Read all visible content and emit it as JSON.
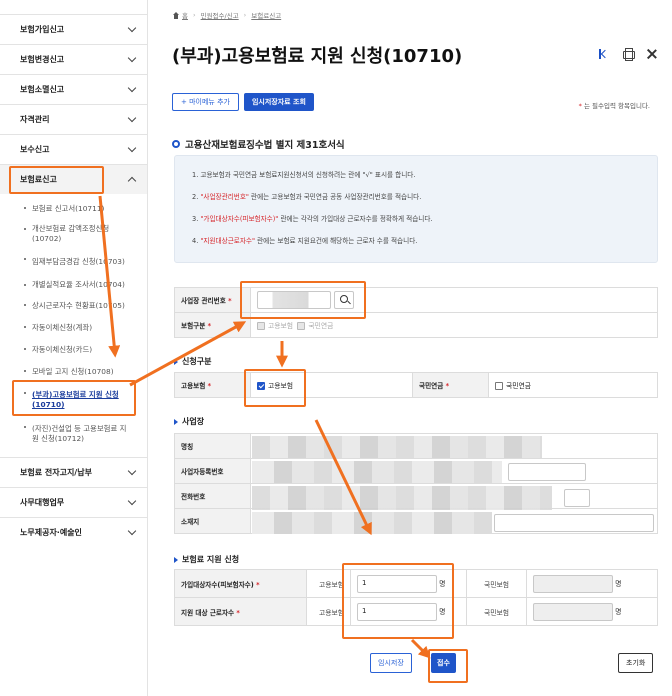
{
  "sidebar": {
    "items": [
      {
        "label": "보험가입신고"
      },
      {
        "label": "보험변경신고"
      },
      {
        "label": "보험소멸신고"
      },
      {
        "label": "자격관리"
      },
      {
        "label": "보수신고"
      },
      {
        "label": "보험료신고"
      },
      {
        "label": "보험료 전자고지/납부"
      },
      {
        "label": "사무대행업무"
      },
      {
        "label": "노무제공자·예술인"
      }
    ],
    "sub_items": [
      {
        "label": "보험료 신고서(10711)"
      },
      {
        "label": "개산보험료 감액조정신청 (10702)"
      },
      {
        "label": "임재부담금경감 신청(10703)"
      },
      {
        "label": "개별실적요율 조사서(10704)"
      },
      {
        "label": "상시근로자수 현황표(10705)"
      },
      {
        "label": "자동이체신청(계좌)"
      },
      {
        "label": "자동이체신청(카드)"
      },
      {
        "label": "모바일 고지 신청(10708)"
      },
      {
        "label": "(부과)고용보험료 지원 신청(10710)"
      },
      {
        "label": "(자진)건설업 등 고용보험료 지원 신청(10712)"
      }
    ]
  },
  "breadcrumb": {
    "home": "홈",
    "level1": "민원접수/신고",
    "level2": "보험료신고"
  },
  "page": {
    "title": "(부과)고용보험료 지원 신청(10710)",
    "add_menu_label": "+ 마이메뉴 추가",
    "temp_load_label": "임시저장자료 조회",
    "required_note": "는 필수입력 항목입니다.",
    "required_mark": "*",
    "section_title": "고용산재보험료징수법 별지 제31호서식"
  },
  "info": {
    "line1": "1. 고용보험과 국민연금 보험료지원신청서의 신청하려는 란에 \"√\" 표시를 합니다.",
    "line2_red": "\"사업장관리번호\"",
    "line2": " 란에는 고용보험과 국민연금 공동 사업장관리번호를 적습니다.",
    "line3_red": "\"가입대상자수(피보험자수)\"",
    "line3": " 란에는 각각의 가입대상 근로자수를 정확하게 적습니다.",
    "line4_red": "\"지원대상근로자수\"",
    "line4": " 란에는 보험료 지원요건에 해당하는 근로자 수를 적습니다.",
    "num2": "2. ",
    "num3": "3. ",
    "num4": "4. "
  },
  "form": {
    "biz_no_label": "사업장 관리번호",
    "ins_type_label": "보험구분",
    "emp_ins": "고용보험",
    "pension": "국민연금",
    "apply_section": "신청구분",
    "emp_ins_label": "고용보험",
    "pension_label": "국민연금",
    "site_section": "사업장",
    "name_label": "명칭",
    "reg_no_label": "사업자등록번호",
    "phone_label": "전화번호",
    "address_label": "소재지",
    "support_section": "보험료 지원 신청",
    "insured_label": "가입대상자수(피보험자수)",
    "target_label": "지원 대상 근로자수",
    "emp_ins_short": "고용보험",
    "pension_short": "국민보험",
    "insured_value": "1",
    "target_value": "1",
    "unit": "명"
  },
  "buttons": {
    "temp_save": "임시저장",
    "submit": "접수",
    "reset": "초기화"
  },
  "colors": {
    "primary": "#1f55c9",
    "annotation": "#f07020",
    "required": "#d6262b"
  }
}
